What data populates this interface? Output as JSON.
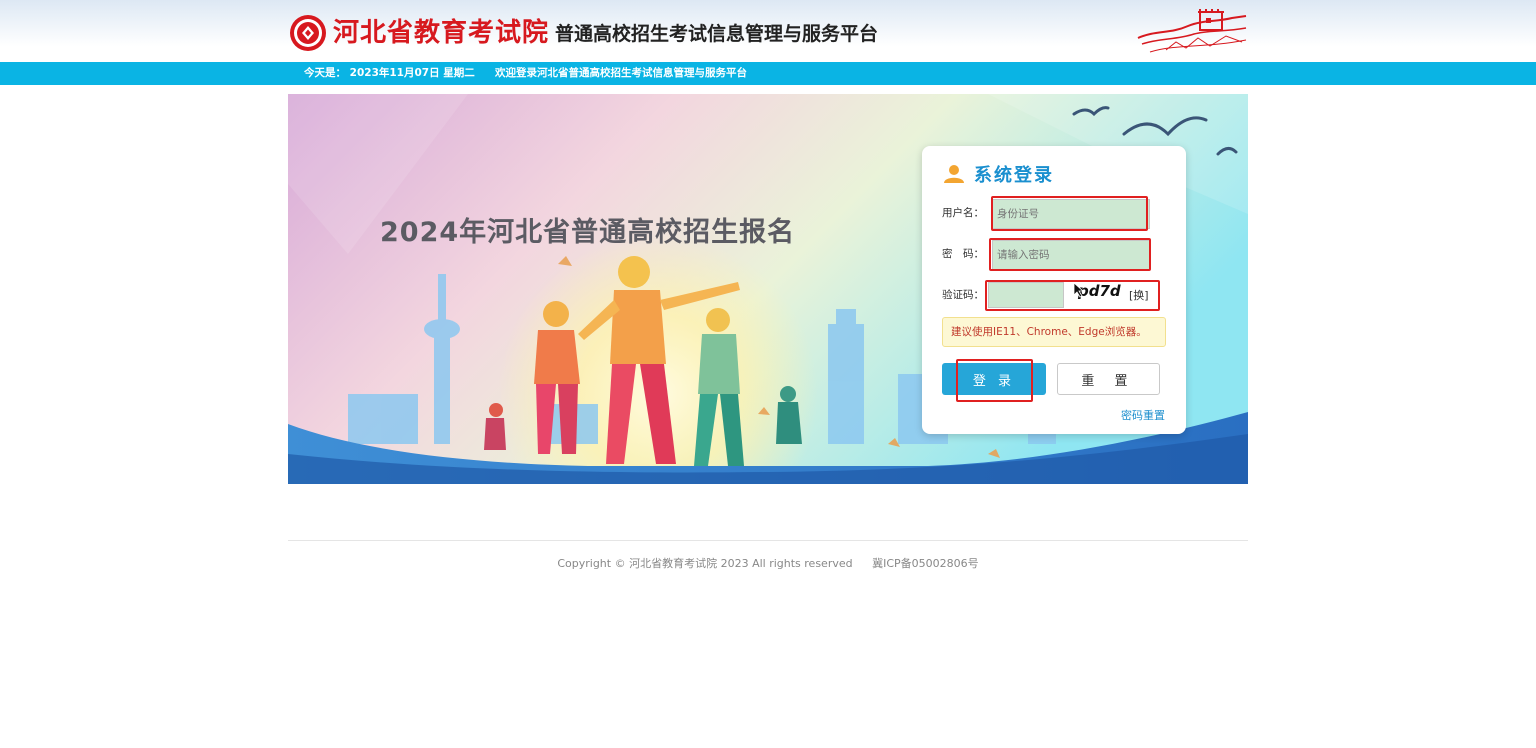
{
  "header": {
    "org_name": "河北省教育考试院",
    "platform_title": "普通高校招生考试信息管理与服务平台",
    "logo_icon": "exam-institute-emblem-icon",
    "decor_icon": "great-wall-icon"
  },
  "strip": {
    "date_text": "今天是： 2023年11月07日 星期二",
    "welcome_text": "欢迎登录河北省普通高校招生考试信息管理与服务平台"
  },
  "banner": {
    "title": "2024年河北省普通高校招生报名"
  },
  "login": {
    "title": "系统登录",
    "user_icon": "user-icon",
    "username_label": "用户名：",
    "username_placeholder": "身份证号",
    "password_label": "密　码：",
    "password_placeholder": "请输入密码",
    "captcha_label": "验证码：",
    "captcha_value": "",
    "captcha_code": "pd7d",
    "captcha_refresh": "[换]",
    "browser_tip": "建议使用IE11、Chrome、Edge浏览器。",
    "login_button": "登 录",
    "reset_button": "重 置",
    "reset_password_link": "密码重置"
  },
  "footer": {
    "copyright": "Copyright © 河北省教育考试院 2023 All rights reserved",
    "icp": "冀ICP备05002806号"
  },
  "colors": {
    "accent": "#0ab4e4",
    "brand_red": "#d7191f",
    "login_button": "#26a6d8",
    "highlight_outline": "#e02020"
  }
}
